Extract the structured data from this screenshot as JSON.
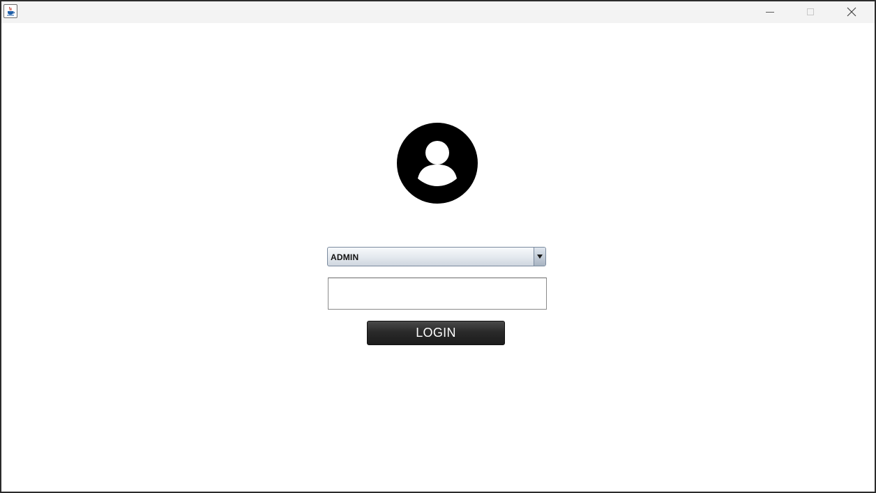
{
  "window": {
    "controls": {
      "minimize_icon": "minimize-icon",
      "maximize_icon": "maximize-icon",
      "close_icon": "close-icon"
    },
    "app_icon": "java-cup-icon"
  },
  "login": {
    "avatar_icon": "user-avatar-icon",
    "role_select": {
      "value": "ADMIN"
    },
    "password": {
      "value": ""
    },
    "login_button_label": "LOGIN"
  },
  "colors": {
    "button_bg": "#222222",
    "button_text": "#ffffff",
    "avatar": "#000000"
  }
}
